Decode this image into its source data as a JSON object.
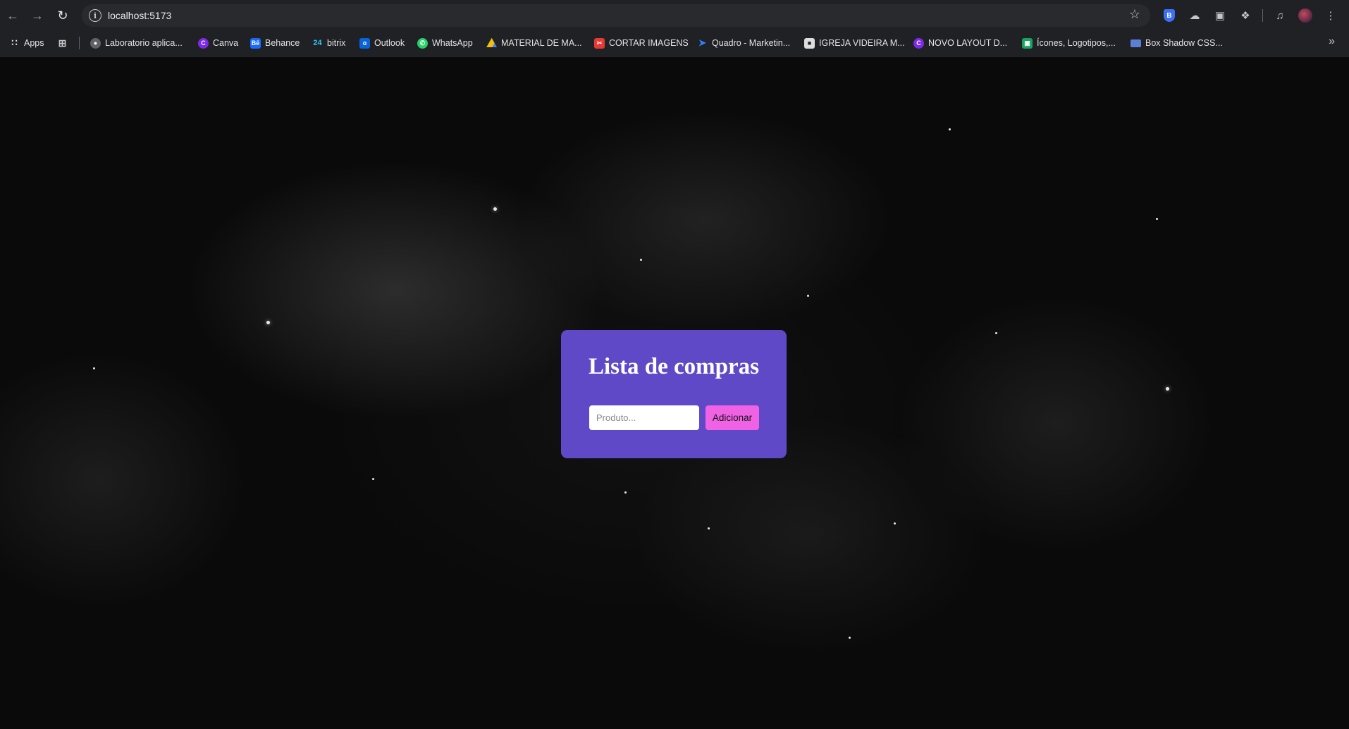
{
  "browser": {
    "url": "localhost:5173",
    "bookmarks": [
      {
        "label": "Apps",
        "icon": "apps-grid-icon",
        "color": "#e8eaed"
      },
      {
        "label": "Laboratorio aplica...",
        "icon": "globe-icon",
        "color": "#c4c7c5"
      },
      {
        "label": "Canva",
        "icon": "canva-icon",
        "color": "#7d2ae8"
      },
      {
        "label": "Behance",
        "icon": "behance-icon",
        "color": "#1769ff"
      },
      {
        "label": "bitrix",
        "icon": "bitrix-icon",
        "color": "#2fc6f6"
      },
      {
        "label": "Outlook",
        "icon": "outlook-icon",
        "color": "#0a64d8"
      },
      {
        "label": "WhatsApp",
        "icon": "whatsapp-icon",
        "color": "#25d366"
      },
      {
        "label": "MATERIAL DE MA...",
        "icon": "google-drive-icon",
        "color": "#fbbc04"
      },
      {
        "label": "CORTAR IMAGENS",
        "icon": "crop-tool-icon",
        "color": "#e53935"
      },
      {
        "label": "Quadro - Marketin...",
        "icon": "jira-icon",
        "color": "#2684ff"
      },
      {
        "label": "IGREJA VIDEIRA M...",
        "icon": "church-site-icon",
        "color": "#dddddd"
      },
      {
        "label": "NOVO LAYOUT D...",
        "icon": "canva-icon",
        "color": "#7d2ae8"
      },
      {
        "label": "Ícones, Logotipos,...",
        "icon": "icons-site-icon",
        "color": "#1aa260"
      },
      {
        "label": "Box Shadow CSS...",
        "icon": "box-shadow-site-icon",
        "color": "#5b7fd6"
      }
    ]
  },
  "app": {
    "title": "Lista de compras",
    "input_placeholder": "Produto...",
    "input_value": "",
    "add_button_label": "Adicionar",
    "colors": {
      "card": "#6049c7",
      "button": "#f062e4",
      "background": "#0a0a0a"
    }
  }
}
